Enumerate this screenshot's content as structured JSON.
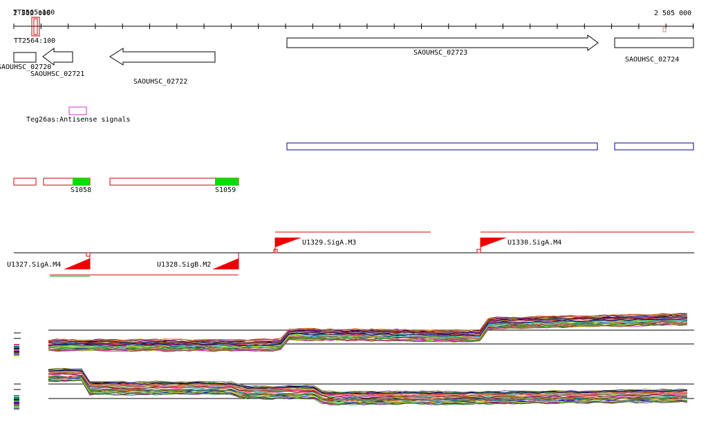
{
  "ruler": {
    "left_label": "2 502 000",
    "left_overlay_label": "TT2565:100",
    "right_label": "2 505 000",
    "marker_label": "TT2564:100"
  },
  "genes": [
    {
      "id": "g720",
      "label": "SAOUHSC_02720"
    },
    {
      "id": "g721",
      "label": "SAOUHSC_02721"
    },
    {
      "id": "g722",
      "label": "SAOUHSC_02722"
    },
    {
      "id": "g723",
      "label": "SAOUHSC_02723"
    },
    {
      "id": "g724",
      "label": "SAOUHSC_02724"
    }
  ],
  "antisense": {
    "label": "Teg26as:Antisense signals",
    "color": "#cc33cc"
  },
  "segments": [
    {
      "id": "s1058",
      "label": "S1058",
      "color": "#00dd00"
    },
    {
      "id": "s1059",
      "label": "S1059",
      "color": "#00dd00"
    }
  ],
  "promoters": [
    {
      "id": "u1327",
      "label": "U1327.SigA.M4"
    },
    {
      "id": "u1328",
      "label": "U1328.SigB.M2"
    },
    {
      "id": "u1329",
      "label": "U1329.SigA.M3"
    },
    {
      "id": "u1330",
      "label": "U1330.SigA.M4"
    }
  ],
  "colors": {
    "track_red": "#cc0000",
    "track_blue": "#000099",
    "promoter_fill": "#ee0000"
  }
}
